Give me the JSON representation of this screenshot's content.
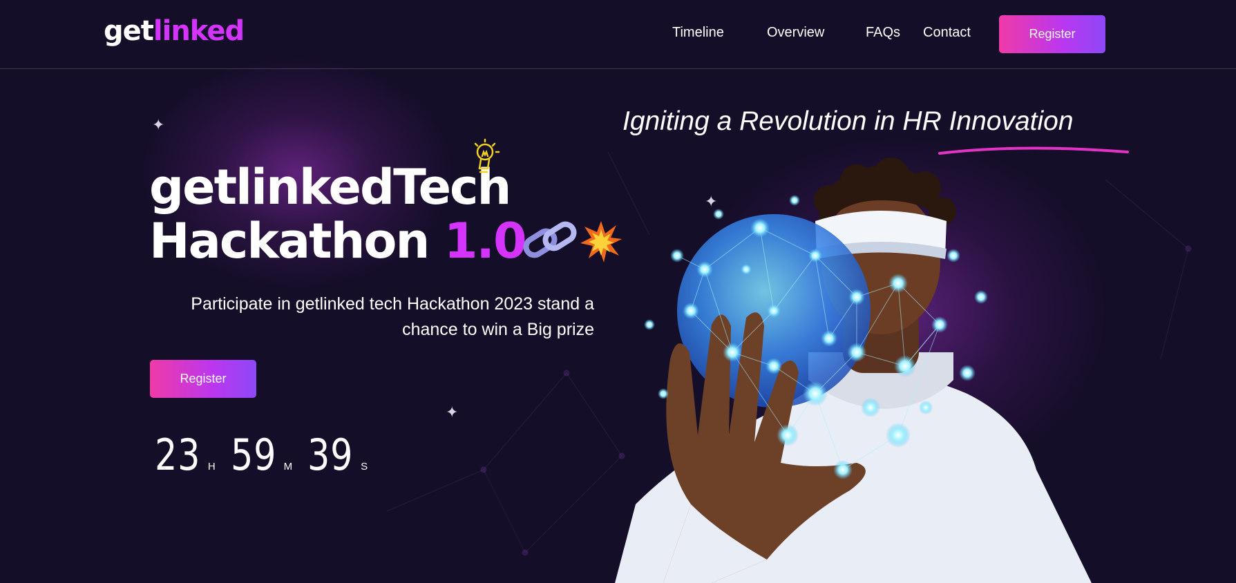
{
  "header": {
    "logo_part1": "get",
    "logo_part2": "linked",
    "nav": [
      {
        "label": "Timeline"
      },
      {
        "label": "Overview"
      },
      {
        "label": "FAQs"
      },
      {
        "label": "Contact"
      }
    ],
    "register_label": "Register"
  },
  "hero": {
    "title_line1": "getlinkedTech",
    "title_line2_word": "Hackathon",
    "title_line2_accent": "1.0",
    "subtitle": "Participate in getlinked tech Hackathon 2023 stand a chance to win a Big prize",
    "register_label": "Register",
    "countdown": {
      "hours": "23",
      "hours_unit": "H",
      "minutes": "59",
      "minutes_unit": "M",
      "seconds": "39",
      "seconds_unit": "S"
    },
    "tagline": "Igniting a Revolution in HR Innovation",
    "icons": [
      "lightbulb-icon",
      "chain-link-icon",
      "explosion-icon",
      "sparkle-icon"
    ]
  },
  "colors": {
    "background": "#150e28",
    "accent": "#d434fe",
    "button_gradient_start": "#f03aa8",
    "button_gradient_end": "#8e48f8",
    "underline": "#e233c5"
  }
}
